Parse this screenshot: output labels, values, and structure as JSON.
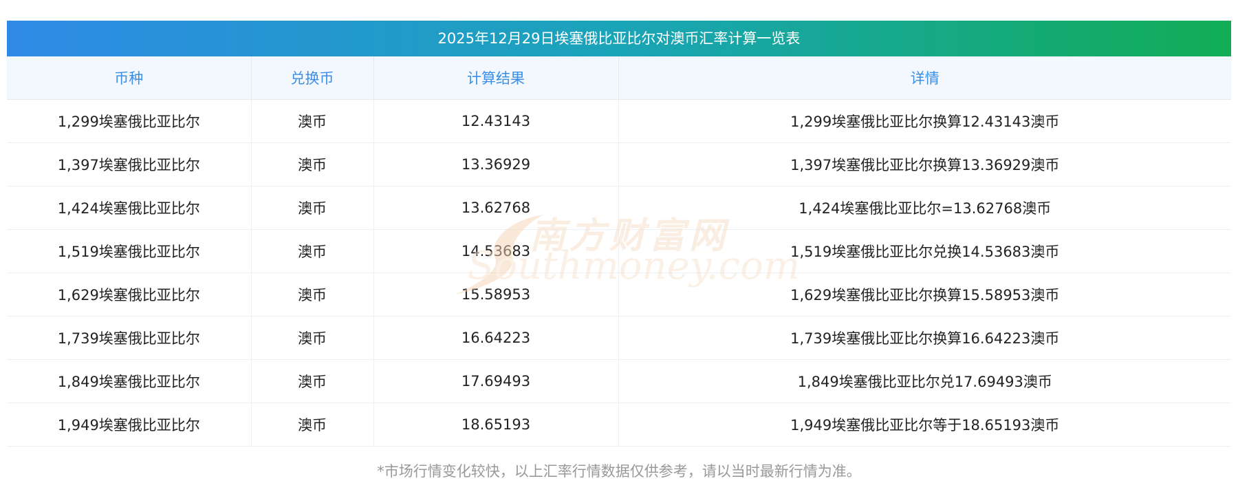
{
  "title": "2025年12月29日埃塞俄比亚比尔对澳币汇率计算一览表",
  "headers": [
    "币种",
    "兑换币",
    "计算结果",
    "详情"
  ],
  "rows": [
    {
      "currency": "1,299埃塞俄比亚比尔",
      "target": "澳币",
      "result": "12.43143",
      "detail": "1,299埃塞俄比亚比尔换算12.43143澳币"
    },
    {
      "currency": "1,397埃塞俄比亚比尔",
      "target": "澳币",
      "result": "13.36929",
      "detail": "1,397埃塞俄比亚比尔换算13.36929澳币"
    },
    {
      "currency": "1,424埃塞俄比亚比尔",
      "target": "澳币",
      "result": "13.62768",
      "detail": "1,424埃塞俄比亚比尔=13.62768澳币"
    },
    {
      "currency": "1,519埃塞俄比亚比尔",
      "target": "澳币",
      "result": "14.53683",
      "detail": "1,519埃塞俄比亚比尔兑换14.53683澳币"
    },
    {
      "currency": "1,629埃塞俄比亚比尔",
      "target": "澳币",
      "result": "15.58953",
      "detail": "1,629埃塞俄比亚比尔换算15.58953澳币"
    },
    {
      "currency": "1,739埃塞俄比亚比尔",
      "target": "澳币",
      "result": "16.64223",
      "detail": "1,739埃塞俄比亚比尔换算16.64223澳币"
    },
    {
      "currency": "1,849埃塞俄比亚比尔",
      "target": "澳币",
      "result": "17.69493",
      "detail": "1,849埃塞俄比亚比尔兑17.69493澳币"
    },
    {
      "currency": "1,949埃塞俄比亚比尔",
      "target": "澳币",
      "result": "18.65193",
      "detail": "1,949埃塞俄比亚比尔等于18.65193澳币"
    }
  ],
  "note": "*市场行情变化较快，以上汇率行情数据仅供参考，请以当时最新行情为准。",
  "watermark": {
    "cn": "南方财富网",
    "en": "Southmoney.com"
  },
  "colors": {
    "header_text": "#3a8ee6",
    "header_bg": "#f3f8fe",
    "title_start": "#2e8ae6",
    "title_end": "#12ad55",
    "note": "#999999"
  }
}
